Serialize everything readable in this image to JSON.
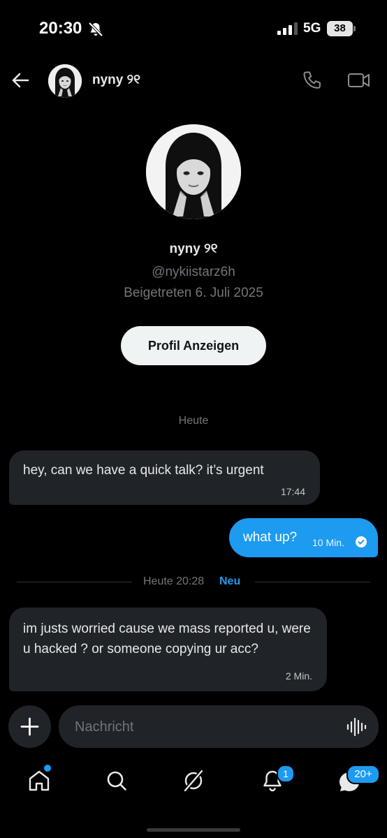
{
  "status_bar": {
    "time": "20:30",
    "network": "5G",
    "battery": "38",
    "icons": [
      "bell-off-icon",
      "signal-icon",
      "battery-icon"
    ]
  },
  "header": {
    "name": "nyny ୨୧",
    "icons": [
      "back-arrow-icon",
      "phone-icon",
      "video-icon"
    ]
  },
  "profile": {
    "name": "nyny ୨୧",
    "handle": "@nykiistarz6h",
    "joined": "Beigetreten 6. Juli 2025",
    "button_label": "Profil Anzeigen"
  },
  "chat": {
    "day_label": "Heute",
    "messages": [
      {
        "direction": "in",
        "text": "hey, can we have a quick talk? it’s urgent",
        "time": "17:44"
      },
      {
        "direction": "out",
        "text": "what up?",
        "time": "10 Min.",
        "status": "read"
      },
      {
        "direction": "in",
        "text": "im justs worried cause we mass reported u, were u hacked ? or someone copying ur acc?",
        "time": "2 Min."
      }
    ],
    "new_separator": {
      "label": "Heute 20:28",
      "new_label": "Neu"
    }
  },
  "composer": {
    "placeholder": "Nachricht",
    "icons": [
      "plus-icon",
      "voice-wave-icon"
    ]
  },
  "bottom_nav": {
    "items": [
      "home-icon",
      "search-icon",
      "grok-icon",
      "notifications-icon",
      "messages-icon"
    ],
    "notifications_badge": "1",
    "messages_badge": "20+"
  },
  "colors": {
    "background": "#000000",
    "accent": "#1d9bf0",
    "bubble_in": "#202327",
    "muted": "#71767b"
  }
}
